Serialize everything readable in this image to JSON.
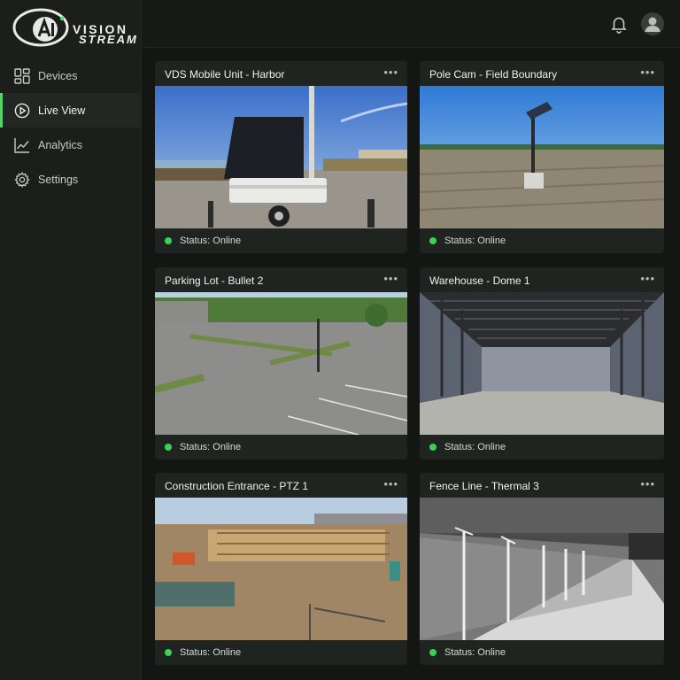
{
  "brand": {
    "logo_letters": "AI",
    "line1": "VISION",
    "line2": "STREAM",
    "accent": "#55d46a"
  },
  "sidebar": {
    "items": [
      {
        "label": "Devices",
        "icon": "grid-icon",
        "active": false
      },
      {
        "label": "Live View",
        "icon": "play-circle-icon",
        "active": true
      },
      {
        "label": "Analytics",
        "icon": "trend-line-icon",
        "active": false
      },
      {
        "label": "Settings",
        "icon": "gear-icon",
        "active": false
      }
    ]
  },
  "header": {
    "notifications_icon": "bell-icon",
    "profile_icon": "user-avatar-icon"
  },
  "cameras": [
    {
      "title": "VDS Mobile Unit - Harbor",
      "status": "Status: Online",
      "status_color": "#39d353"
    },
    {
      "title": "Pole Cam - Field Boundary",
      "status": "Status: Online",
      "status_color": "#39d353"
    },
    {
      "title": "Parking Lot - Bullet 2",
      "status": "Status: Online",
      "status_color": "#39d353"
    },
    {
      "title": "Warehouse - Dome 1",
      "status": "Status: Online",
      "status_color": "#39d353"
    },
    {
      "title": "Construction Entrance - PTZ 1",
      "status": "Status: Online",
      "status_color": "#39d353"
    },
    {
      "title": "Fence Line - Thermal 3",
      "status": "Status: Online",
      "status_color": "#39d353"
    }
  ],
  "card_menu_glyph": "•••"
}
